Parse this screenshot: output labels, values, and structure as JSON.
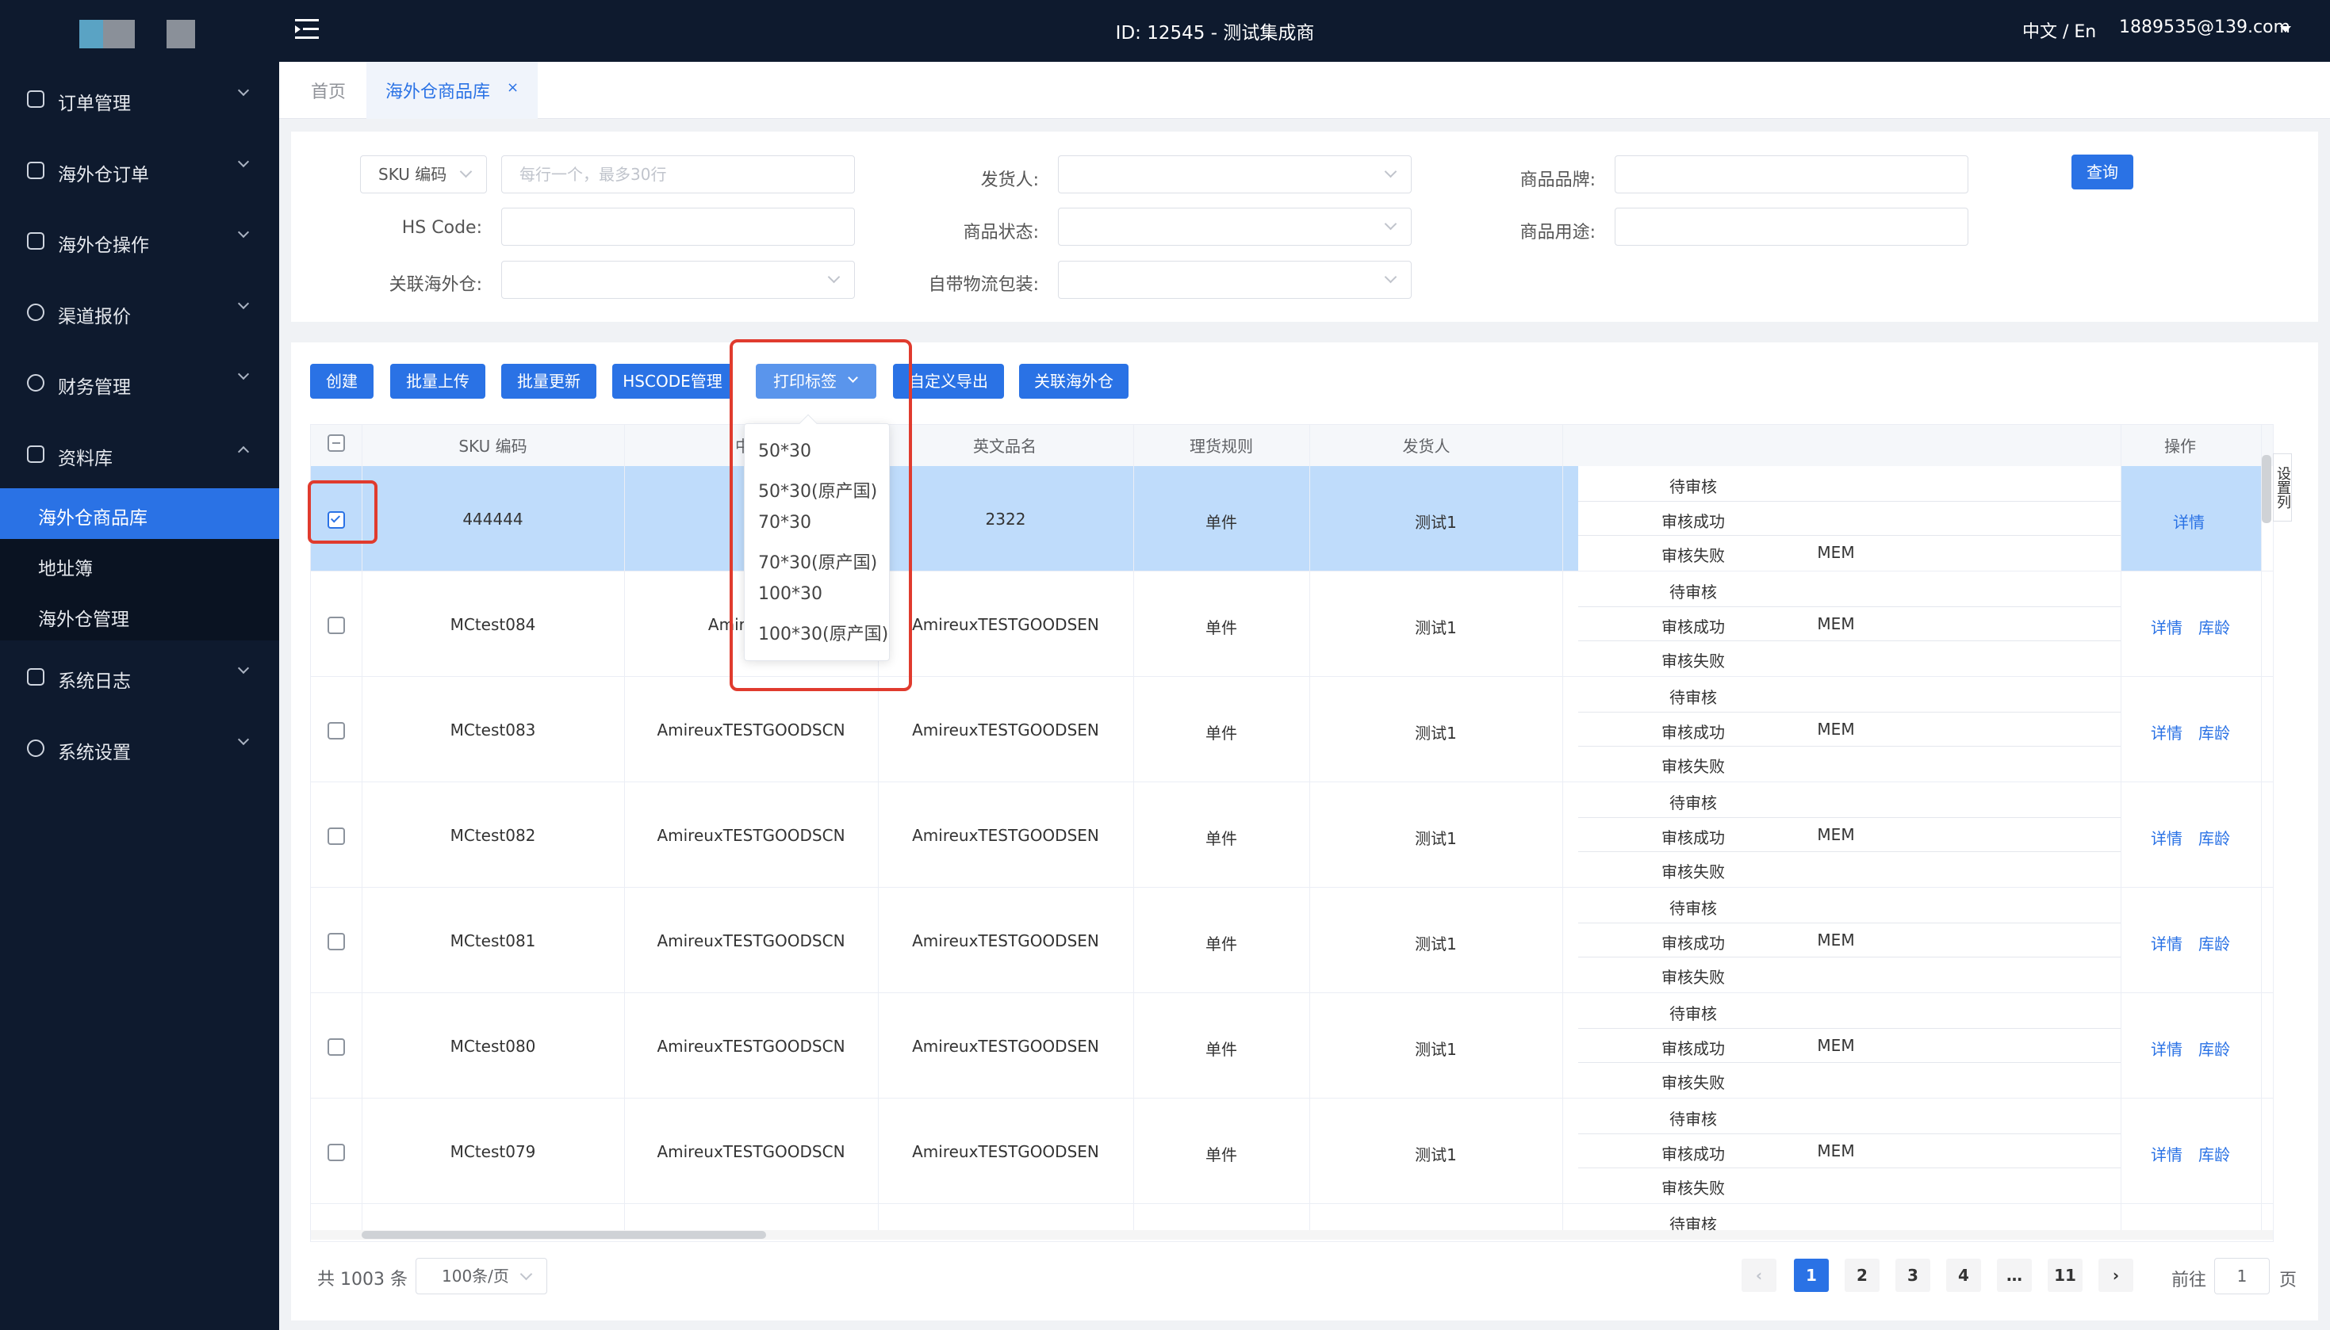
{
  "app": {
    "user_id_label": "ID: 12545 - 测试集成商",
    "language": "中文 / En",
    "user_email": "1889535@139.com"
  },
  "sidebar": {
    "items": [
      {
        "label": "订单管理",
        "icon": "order-icon"
      },
      {
        "label": "海外仓订单",
        "icon": "list-icon"
      },
      {
        "label": "海外仓操作",
        "icon": "warehouse-icon"
      },
      {
        "label": "渠道报价",
        "icon": "channel-icon"
      },
      {
        "label": "财务管理",
        "icon": "yen-icon"
      },
      {
        "label": "资料库",
        "icon": "grid-icon"
      },
      {
        "label": "系统日志",
        "icon": "calendar-icon"
      },
      {
        "label": "系统设置",
        "icon": "gear-icon"
      }
    ],
    "sub_items": [
      "海外仓商品库",
      "地址簿",
      "海外仓管理"
    ]
  },
  "tabs": {
    "home": "首页",
    "current": "海外仓商品库",
    "close": "×"
  },
  "filters": {
    "sku_select": "SKU 编码",
    "sku_placeholder": "每行一个，最多30行",
    "hs_code": "HS Code:",
    "related_warehouse": "关联海外仓:",
    "shipper": "发货人:",
    "product_status": "商品状态:",
    "own_logistics": "自带物流包装:",
    "brand": "商品品牌:",
    "usage": "商品用途:",
    "query": "查询"
  },
  "toolbar": {
    "create": "创建",
    "batch_upload": "批量上传",
    "batch_update": "批量更新",
    "hscode": "HSCODE管理",
    "print_label": "打印标签",
    "custom_export": "自定义导出",
    "link_warehouse": "关联海外仓"
  },
  "dropdown": [
    "50*30",
    "50*30(原产国)",
    "70*30",
    "70*30(原产国)",
    "100*30",
    "100*30(原产国)"
  ],
  "table": {
    "headers": {
      "sku": "SKU 编码",
      "cn": "中文",
      "en": "英文品名",
      "rule": "理货规则",
      "shipper": "发货人",
      "action": "操作",
      "settings": "设置列"
    },
    "statuses": [
      "待审核",
      "审核成功",
      "审核失败"
    ],
    "mem": "MEM",
    "detail": "详情",
    "age": "库龄",
    "rows": [
      {
        "sku": "444444",
        "cn": "",
        "en": "2322",
        "rule": "单件",
        "shipper": "测试1",
        "mem_row": 2
      },
      {
        "sku": "MCtest084",
        "cn": "AmireuxTE",
        "en": "AmireuxTESTGOODSEN",
        "rule": "单件",
        "shipper": "测试1",
        "mem_row": 1
      },
      {
        "sku": "MCtest083",
        "cn": "AmireuxTESTGOODSCN",
        "en": "AmireuxTESTGOODSEN",
        "rule": "单件",
        "shipper": "测试1",
        "mem_row": 1
      },
      {
        "sku": "MCtest082",
        "cn": "AmireuxTESTGOODSCN",
        "en": "AmireuxTESTGOODSEN",
        "rule": "单件",
        "shipper": "测试1",
        "mem_row": 1
      },
      {
        "sku": "MCtest081",
        "cn": "AmireuxTESTGOODSCN",
        "en": "AmireuxTESTGOODSEN",
        "rule": "单件",
        "shipper": "测试1",
        "mem_row": 1
      },
      {
        "sku": "MCtest080",
        "cn": "AmireuxTESTGOODSCN",
        "en": "AmireuxTESTGOODSEN",
        "rule": "单件",
        "shipper": "测试1",
        "mem_row": 1
      },
      {
        "sku": "MCtest079",
        "cn": "AmireuxTESTGOODSCN",
        "en": "AmireuxTESTGOODSEN",
        "rule": "单件",
        "shipper": "测试1",
        "mem_row": 1
      }
    ],
    "partial_status": "待审核"
  },
  "pagination": {
    "total": "共 1003 条",
    "per_page": "100条/页",
    "pages": [
      "1",
      "2",
      "3",
      "4",
      "…",
      "11"
    ],
    "goto": "前往",
    "page_input": "1",
    "page_suffix": "页"
  },
  "colors": {
    "sidebar_bg": "#0e1a2e",
    "accent": "#2a72e5",
    "selected_row": "#bfdcfb",
    "highlight_box": "#e03b2e"
  }
}
